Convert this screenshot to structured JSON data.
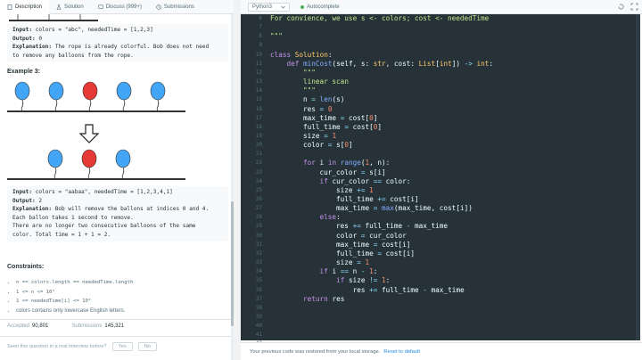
{
  "tabs": [
    {
      "label": "Description",
      "icon": "document-icon"
    },
    {
      "label": "Solution",
      "icon": "flask-icon"
    },
    {
      "label": "Discuss (999+)",
      "icon": "chat-icon"
    },
    {
      "label": "Submissions",
      "icon": "clock-icon"
    }
  ],
  "example2": {
    "input_label": "Input:",
    "input_value": "colors = \"abc\", neededTime = [1,2,3]",
    "output_label": "Output:",
    "output_value": "0",
    "explanation_label": "Explanation:",
    "explanation_text": "The rope is already colorful. Bob does not need",
    "explanation_text2": "to remove any balloons from the rope."
  },
  "example3": {
    "title": "Example 3:",
    "input_label": "Input:",
    "input_value": "colors = \"aabaa\", neededTime = [1,2,3,4,1]",
    "output_label": "Output:",
    "output_value": "2",
    "explanation_label": "Explanation:",
    "explanation_text": "Bob will remove the ballons at indices 0 and 4.",
    "explanation_line2": "Each ballon takes 1 second to remove.",
    "explanation_line3": "There are no longer two consecutive balloons of the same",
    "explanation_line4": "color. Total time = 1 + 1 = 2."
  },
  "balloons_top": [
    "blue",
    "blue",
    "red",
    "blue",
    "blue"
  ],
  "balloons_bottom": [
    "blue",
    "red",
    "blue"
  ],
  "constraints": {
    "title": "Constraints:",
    "items": [
      "n == colors.length == neededTime.length",
      "1 <= n <= 10⁵",
      "1 <= neededTime[i] <= 10⁴",
      "colors contains only lowercase English letters."
    ]
  },
  "stats": {
    "accepted_label": "Accepted",
    "accepted_value": "90,801",
    "submissions_label": "Submissions",
    "submissions_value": "145,321"
  },
  "interview": {
    "question": "Seen this question in a real interview before?",
    "yes": "Yes",
    "no": "No"
  },
  "editor": {
    "language": "Python3",
    "autocomplete": "Autocomplete",
    "status_text": "Your previous code was restored from your local storage.",
    "reset_link": "Reset to default"
  },
  "code_lines": [
    {
      "n": "6",
      "html": "For convience, we use s <- colors; cost <- neededTime",
      "cls": "cm"
    },
    {
      "n": "7",
      "html": ""
    },
    {
      "n": "8",
      "html": "\"\"\"",
      "cls": "cm"
    },
    {
      "n": "9",
      "html": ""
    },
    {
      "n": "10",
      "html": "<span class='kw'>class</span> <span class='ty'>Solution</span>:"
    },
    {
      "n": "11",
      "html": "    <span class='kw'>def</span> <span class='fn'>minCost</span>(self, s: <span class='ty'>str</span>, cost: <span class='ty'>List</span>[<span class='ty'>int</span>]) <span class='op'>-&gt;</span> <span class='ty'>int</span>:"
    },
    {
      "n": "12",
      "html": "        <span class='cm'>\"\"\"</span>"
    },
    {
      "n": "13",
      "html": "        <span class='cm'>linear scan</span>"
    },
    {
      "n": "14",
      "html": "        <span class='cm'>\"\"\"</span>"
    },
    {
      "n": "15",
      "html": "        n <span class='op'>=</span> <span class='fn'>len</span>(s)"
    },
    {
      "n": "16",
      "html": "        res <span class='op'>=</span> <span class='nm'>0</span>"
    },
    {
      "n": "17",
      "html": "        max_time <span class='op'>=</span> cost[<span class='nm'>0</span>]"
    },
    {
      "n": "18",
      "html": "        full_time <span class='op'>=</span> cost[<span class='nm'>0</span>]"
    },
    {
      "n": "19",
      "html": "        size <span class='op'>=</span> <span class='nm'>1</span>"
    },
    {
      "n": "20",
      "html": "        color <span class='op'>=</span> s[<span class='nm'>0</span>]"
    },
    {
      "n": "21",
      "html": ""
    },
    {
      "n": "22",
      "html": "        <span class='kw'>for</span> i <span class='kw'>in</span> <span class='fn'>range</span>(<span class='nm'>1</span>, n):"
    },
    {
      "n": "23",
      "html": "            cur_color <span class='op'>=</span> s[i]"
    },
    {
      "n": "24",
      "html": "            <span class='kw'>if</span> cur_color <span class='op'>==</span> color:"
    },
    {
      "n": "25",
      "html": "                size <span class='op'>+=</span> <span class='nm'>1</span>"
    },
    {
      "n": "26",
      "html": "                full_time <span class='op'>+=</span> cost[i]"
    },
    {
      "n": "27",
      "html": "                max_time <span class='op'>=</span> <span class='fn'>max</span>(max_time, cost[i])"
    },
    {
      "n": "28",
      "html": "            <span class='kw'>else</span>:"
    },
    {
      "n": "29",
      "html": "                res <span class='op'>+=</span> full_time <span class='op'>-</span> max_time"
    },
    {
      "n": "30",
      "html": "                color <span class='op'>=</span> cur_color"
    },
    {
      "n": "31",
      "html": "                max_time <span class='op'>=</span> cost[i]"
    },
    {
      "n": "32",
      "html": "                full_time <span class='op'>=</span> cost[i]"
    },
    {
      "n": "33",
      "html": "                size <span class='op'>=</span> <span class='nm'>1</span>"
    },
    {
      "n": "34",
      "html": "            <span class='kw'>if</span> i <span class='op'>==</span> n <span class='op'>-</span> <span class='nm'>1</span>:"
    },
    {
      "n": "35",
      "html": "                <span class='kw'>if</span> size <span class='op'>!=</span> <span class='nm'>1</span>:"
    },
    {
      "n": "36",
      "html": "                    res <span class='op'>+=</span> full_time <span class='op'>-</span> max_time"
    },
    {
      "n": "37",
      "html": "        <span class='kw'>return</span> res"
    },
    {
      "n": "38",
      "html": ""
    },
    {
      "n": "39",
      "html": ""
    },
    {
      "n": "40",
      "html": ""
    },
    {
      "n": "41",
      "html": ""
    },
    {
      "n": "42",
      "html": ""
    },
    {
      "n": "43",
      "html": ""
    },
    {
      "n": "44",
      "html": ""
    },
    {
      "n": "45",
      "html": ""
    }
  ],
  "colors": {
    "code_bg": "#263238",
    "balloon_blue": "#42a5f5",
    "balloon_red": "#e53935"
  }
}
